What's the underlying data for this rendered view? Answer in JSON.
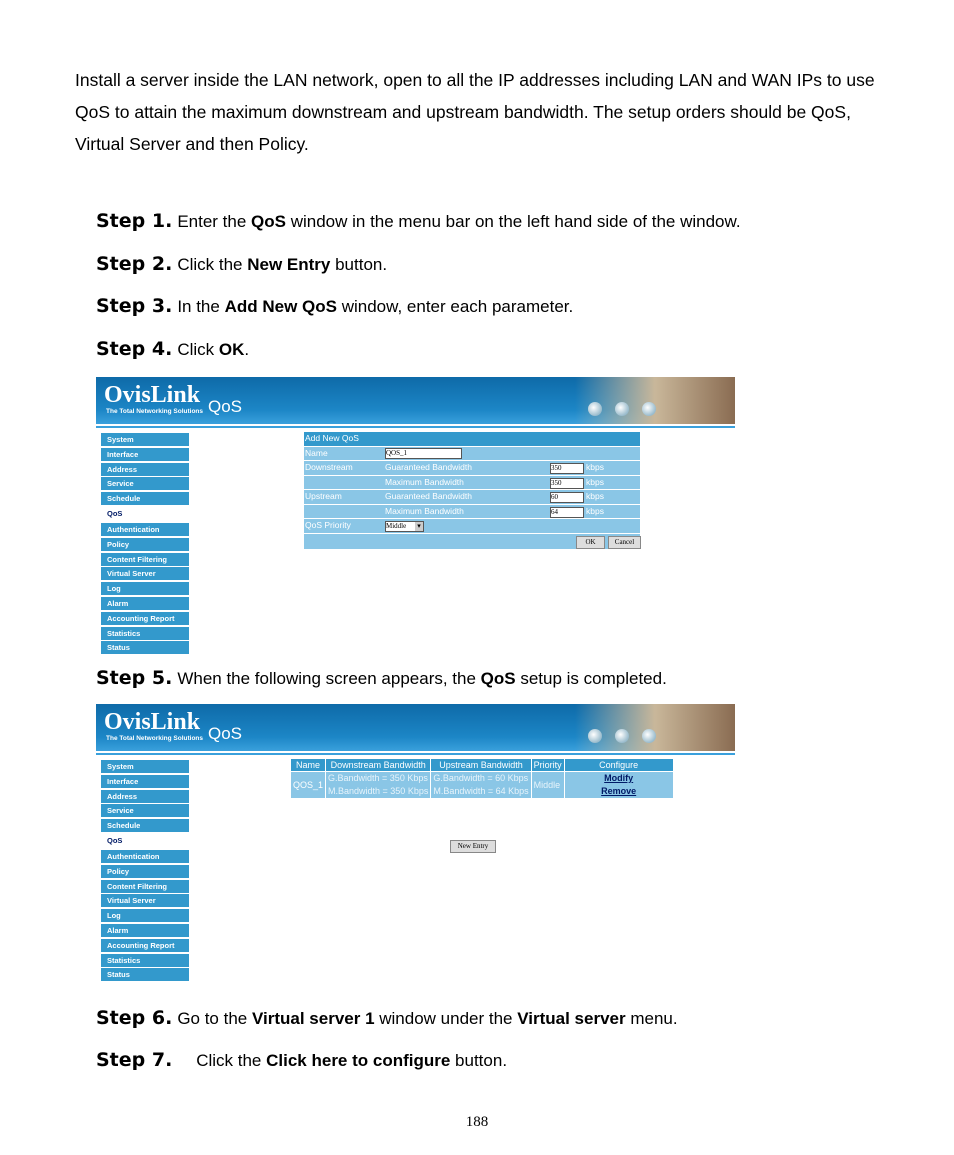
{
  "intro": "Install a server inside the LAN network, open to all the IP addresses including LAN and WAN IPs to use QoS to attain the maximum downstream and upstream bandwidth. The setup orders should be QoS, Virtual Server and then Policy.",
  "steps": [
    {
      "label": "Step 1.",
      "parts": [
        {
          "t": "Enter the "
        },
        {
          "t": "QoS",
          "b": true
        },
        {
          "t": " window in the menu bar on the left hand side of the window."
        }
      ]
    },
    {
      "label": "Step 2.",
      "parts": [
        {
          "t": "Click the "
        },
        {
          "t": "New Entry",
          "b": true
        },
        {
          "t": " button."
        }
      ]
    },
    {
      "label": "Step 3.",
      "parts": [
        {
          "t": "In the "
        },
        {
          "t": "Add New QoS",
          "b": true
        },
        {
          "t": " window, enter each parameter."
        }
      ]
    },
    {
      "label": "Step 4.",
      "parts": [
        {
          "t": "Click "
        },
        {
          "t": "OK",
          "b": true
        },
        {
          "t": "."
        }
      ]
    },
    {
      "label": "Step 5.",
      "parts": [
        {
          "t": "When the following screen appears, the "
        },
        {
          "t": "QoS",
          "b": true
        },
        {
          "t": " setup is completed."
        }
      ]
    },
    {
      "label": "Step 6.",
      "parts": [
        {
          "t": "Go to the "
        },
        {
          "t": "Virtual server 1",
          "b": true
        },
        {
          "t": " window under the "
        },
        {
          "t": "Virtual server",
          "b": true
        },
        {
          "t": " menu."
        }
      ]
    },
    {
      "label": "Step 7.",
      "parts": [
        {
          "t": "    Click the "
        },
        {
          "t": "Click here to configure",
          "b": true
        },
        {
          "t": " button."
        }
      ]
    }
  ],
  "banner": {
    "logo": "OvisLink",
    "tagline": "The Total Networking Solutions",
    "title": "QoS"
  },
  "menu": [
    "System",
    "Interface",
    "Address",
    "Service",
    "Schedule",
    "QoS",
    "Authentication",
    "Policy",
    "Content Filtering",
    "Virtual Server",
    "Log",
    "Alarm",
    "Accounting Report",
    "Statistics",
    "Status"
  ],
  "menu_active": "QoS",
  "form": {
    "title": "Add New QoS",
    "name_label": "Name",
    "name_value": "QOS_1",
    "downstream": "Downstream",
    "upstream": "Upstream",
    "guaranteed": "Guaranteed Bandwidth",
    "maximum": "Maximum Bandwidth",
    "unit": "kbps",
    "down_g": "350",
    "down_m": "350",
    "up_g": "60",
    "up_m": "64",
    "priority_label": "QoS Priority",
    "priority_value": "Middle",
    "ok": "OK",
    "cancel": "Cancel"
  },
  "table": {
    "headers": [
      "Name",
      "Downstream Bandwidth",
      "Upstream Bandwidth",
      "Priority",
      "Configure"
    ],
    "name": "QOS_1",
    "down": [
      "G.Bandwidth =  350 Kbps",
      "M.Bandwidth =  350 Kbps"
    ],
    "up": [
      "G.Bandwidth = 60 Kbps",
      "M.Bandwidth = 64 Kbps"
    ],
    "priority": "Middle",
    "modify": "Modify",
    "remove": "Remove",
    "new_entry": "New Entry"
  },
  "page_number": "188"
}
